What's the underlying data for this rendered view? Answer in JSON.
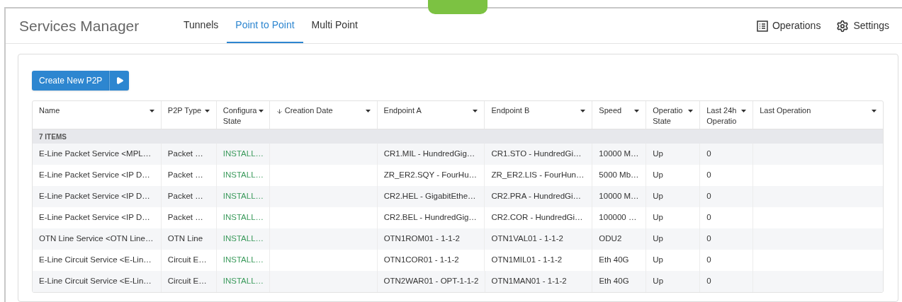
{
  "app_title": "Services Manager",
  "tabs": [
    {
      "label": "Tunnels",
      "selected": false
    },
    {
      "label": "Point to Point",
      "selected": true
    },
    {
      "label": "Multi Point",
      "selected": false
    }
  ],
  "header_actions": [
    {
      "kind": "operations",
      "label": "Operations"
    },
    {
      "kind": "settings",
      "label": "Settings"
    }
  ],
  "create_button": {
    "label": "Create New P2P"
  },
  "table": {
    "columns": [
      {
        "lines": [
          "Name"
        ],
        "sorted": false
      },
      {
        "lines": [
          "P2P Type"
        ],
        "sorted": false
      },
      {
        "lines": [
          "Configura",
          "State"
        ],
        "sorted": false
      },
      {
        "lines": [
          "Creation Date"
        ],
        "sorted": true
      },
      {
        "lines": [
          "Endpoint A"
        ],
        "sorted": false
      },
      {
        "lines": [
          "Endpoint B"
        ],
        "sorted": false
      },
      {
        "lines": [
          "Speed"
        ],
        "sorted": false
      },
      {
        "lines": [
          "Operatio",
          "State"
        ],
        "sorted": false
      },
      {
        "lines": [
          "Last 24h",
          "Operatio"
        ],
        "sorted": false
      },
      {
        "lines": [
          "Last Operation"
        ],
        "sorted": false
      }
    ],
    "group_label": "7 ITEMS",
    "rows": [
      [
        "E-Line Packet Service <MPL…",
        "Packet …",
        "INSTALL…",
        "",
        "CR1.MIL - HundredGig…",
        "CR1.STO - HundredGi…",
        "10000 M…",
        "Up",
        "0",
        ""
      ],
      [
        "E-Line Packet Service <IP D…",
        "Packet …",
        "INSTALL…",
        "",
        "ZR_ER2.SQY - FourHu…",
        "ZR_ER2.LIS - FourHun…",
        "5000 Mb…",
        "Up",
        "0",
        ""
      ],
      [
        "E-Line Packet Service <IP D…",
        "Packet …",
        "INSTALL…",
        "",
        "CR2.HEL - GigabitEthe…",
        "CR2.PRA - HundredGi…",
        "10000 M…",
        "Up",
        "0",
        ""
      ],
      [
        "E-Line Packet Service <IP D…",
        "Packet …",
        "INSTALL…",
        "",
        "CR2.BEL - HundredGig…",
        "CR2.COR - HundredGi…",
        "100000 …",
        "Up",
        "0",
        ""
      ],
      [
        "OTN Line Service <OTN Line…",
        "OTN Line",
        "INSTALL…",
        "",
        "OTN1ROM01 - 1-1-2",
        "OTN1VAL01 - 1-1-2",
        "ODU2",
        "Up",
        "0",
        ""
      ],
      [
        "E-Line Circuit Service <E-Lin…",
        "Circuit E…",
        "INSTALL…",
        "",
        "OTN1COR01 - 1-1-2",
        "OTN1MIL01 - 1-1-2",
        "Eth 40G",
        "Up",
        "0",
        ""
      ],
      [
        "E-Line Circuit Service <E-Lin…",
        "Circuit E…",
        "INSTALL…",
        "",
        "OTN2WAR01 - OPT-1-1-2",
        "OTN1MAN01 - 1-1-2",
        "Eth 40G",
        "Up",
        "0",
        ""
      ]
    ]
  }
}
